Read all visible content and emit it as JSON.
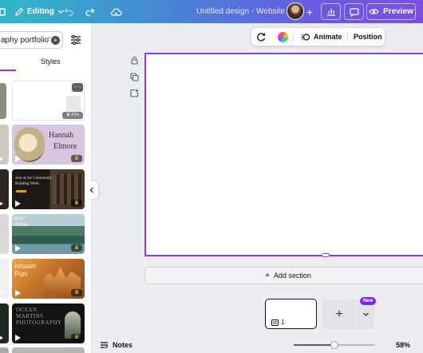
{
  "topbar": {
    "editing_label": "Editing",
    "design_title": "Untitled design - Website",
    "preview_label": "Preview",
    "icons": [
      "folder-icon",
      "pencil-icon",
      "chevron-down-icon",
      "undo-icon",
      "redo-icon",
      "cloud-sync-icon",
      "plus-icon",
      "chart-icon",
      "comment-icon",
      "eye-icon"
    ]
  },
  "panel": {
    "search_value": "aphy portfolio'",
    "tab_styles": "Styles",
    "templates": [
      {
        "name": "blank-white",
        "badge": "Pro"
      },
      {
        "name": "hannah-elmore",
        "line1": "Hannah",
        "line2": "Elmore"
      },
      {
        "name": "community-building",
        "line1": "Join us for Community",
        "line2": "Building Week"
      },
      {
        "name": "kian-garcia",
        "line1": "Kian",
        "line2": "Garcia"
      },
      {
        "name": "ishaan-puri",
        "line1": "Ishaan",
        "line2": "Puri"
      },
      {
        "name": "ocean-martins",
        "line1": "OCEAN",
        "line2": "MARTINS",
        "line3": "PHOTOGRAPHY"
      }
    ]
  },
  "toolbar": {
    "animate_label": "Animate",
    "position_label": "Position"
  },
  "canvas": {
    "add_section_label": "Add section"
  },
  "pages": {
    "page_number": "1",
    "new_badge": "New"
  },
  "footer": {
    "notes_label": "Notes",
    "zoom_value": "58%",
    "zoom_fraction": 0.5
  },
  "colors": {
    "accent": "#8b3dff",
    "badge": "#7d2ae8"
  }
}
